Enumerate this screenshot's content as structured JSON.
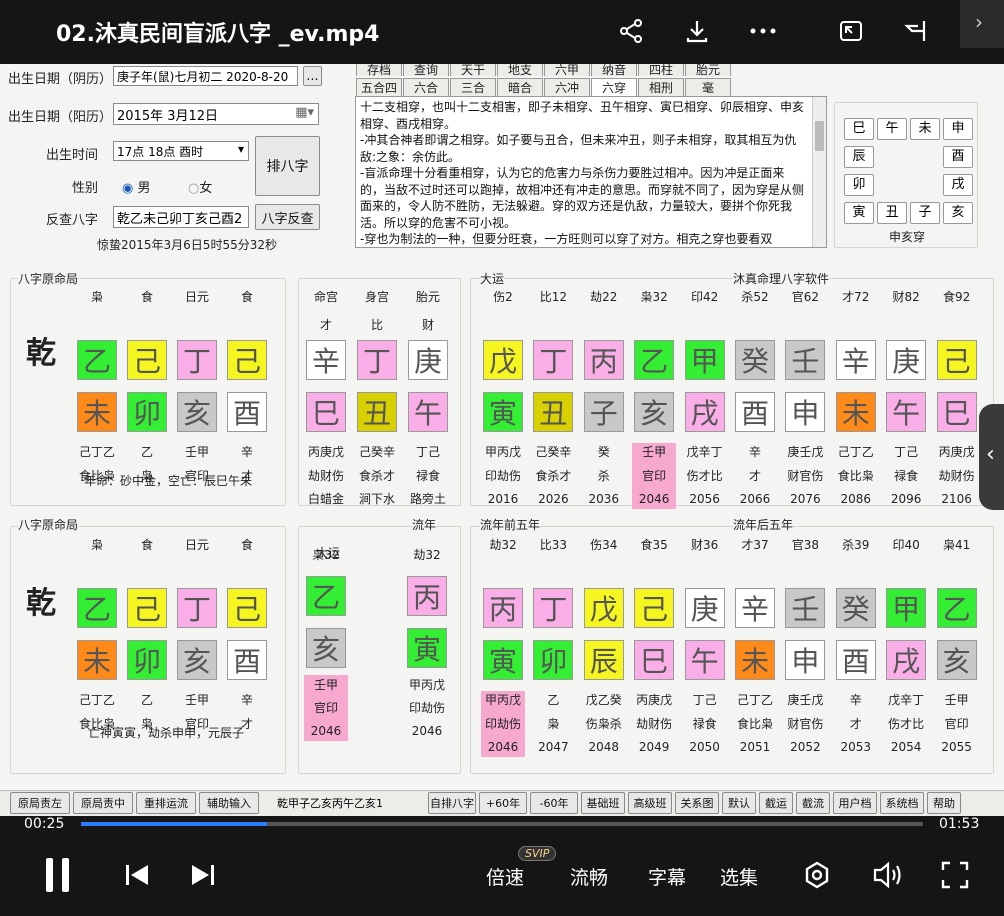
{
  "video": {
    "title": "02.沐真民间盲派八字 _ev.mp4",
    "current_time": "00:25",
    "duration": "01:53",
    "progress": 0.2212,
    "svip": "SVIP",
    "controls": [
      "倍速",
      "流畅",
      "字幕",
      "选集"
    ]
  },
  "form": {
    "lunar_label": "出生日期（阴历）",
    "lunar_value": "庚子年(鼠)七月初二 2020-8-20",
    "more": "...",
    "solar_label": "出生日期（阳历）",
    "solar_value": "2015年  3月12日",
    "time_label": "出生时间",
    "time_value": "17点 18点 酉时",
    "gender_label": "性别",
    "male": "男",
    "female": "女",
    "reverse_label": "反查八字",
    "reverse_value": "乾乙未己卯丁亥己酉2",
    "arrange_btn": "排八字",
    "reverse_btn": "八字反查",
    "jieqi": "惊蛰2015年3月6日5时55分32秒"
  },
  "tabs_row1": [
    "存档",
    "查询",
    "天干",
    "地支",
    "六甲",
    "纳音",
    "四柱",
    "胎元"
  ],
  "tabs_row2": [
    "五合四冲",
    "六合",
    "三合",
    "暗合",
    "六冲",
    "六穿",
    "相刑",
    "毫"
  ],
  "active_tab": "六穿",
  "text_panel": [
    "十二支相穿，也叫十二支相害，即子未相穿、丑午相穿、寅巳相穿、卯辰相穿、申亥相穿、酉戌相穿。",
    "  -冲其合神者即谓之相穿。如子要与丑合，但未来冲丑，则子未相穿，取其相互为仇敌:之象：余仿此。",
    "  -盲派命理十分看重相穿，认为它的危害力与杀伤力要胜过相冲。因为冲是正面来的，当敌不过时还可以跑掉，故相冲还有冲走的意思。而穿就不同了，因为穿是从侧面来的，令人防不胜防，无法躲避。穿的双方还是仇敌，力量较大，要拼个你死我活。所以穿的危害不可小视。",
    "  -穿也为制法的一种，但要分旺衰，一方旺则可以穿了对方。相克之穿也要看双"
  ],
  "zhi_grid": {
    "row1": [
      "巳",
      "午",
      "未",
      "申"
    ],
    "row2_left": "辰",
    "row2_right": "酉",
    "row3_left": "卯",
    "row3_right": "戌",
    "row4": [
      "寅",
      "丑",
      "子",
      "亥"
    ],
    "caption": "申亥穿"
  },
  "panel1": {
    "title": "八字原命局",
    "qian": "乾",
    "heads": [
      "枭",
      "食",
      "日元",
      "食"
    ],
    "stems": [
      "乙",
      "己",
      "丁",
      "己"
    ],
    "branches": [
      "未",
      "卯",
      "亥",
      "酉"
    ],
    "hidden": [
      "己丁乙",
      "乙",
      "壬甲",
      "辛"
    ],
    "gods": [
      "食比枭",
      "枭",
      "官印",
      "才"
    ],
    "note": "年命：砂中金，空亡：辰巳午未"
  },
  "panel2": {
    "heads": [
      "命宫",
      "身宫",
      "胎元"
    ],
    "sub": [
      "才",
      "比",
      "财"
    ],
    "stems": [
      "辛",
      "丁",
      "庚"
    ],
    "branches": [
      "巳",
      "丑",
      "午"
    ],
    "hidden": [
      "丙庚戊",
      "己癸辛",
      "丁己"
    ],
    "gods": [
      "劫财伤",
      "食杀才",
      "禄食"
    ],
    "nayin": [
      "白蜡金",
      "涧下水",
      "路旁土"
    ]
  },
  "panel3": {
    "title": "大运",
    "software": "沐真命理八字软件",
    "heads": [
      "伤2",
      "比12",
      "劫22",
      "枭32",
      "印42",
      "杀52",
      "官62",
      "才72",
      "财82",
      "食92"
    ],
    "stems": [
      "戊",
      "丁",
      "丙",
      "乙",
      "甲",
      "癸",
      "壬",
      "辛",
      "庚",
      "己"
    ],
    "branches": [
      "寅",
      "丑",
      "子",
      "亥",
      "戌",
      "酉",
      "申",
      "未",
      "午",
      "巳"
    ],
    "hidden": [
      "甲丙戊",
      "己癸辛",
      "癸",
      "壬甲",
      "戊辛丁",
      "辛",
      "庚壬戊",
      "己丁乙",
      "丁己",
      "丙庚戊"
    ],
    "gods": [
      "印劫伤",
      "食杀才",
      "杀",
      "官印",
      "伤才比",
      "才",
      "财官伤",
      "食比枭",
      "禄食",
      "劫财伤"
    ],
    "years": [
      "2016",
      "2026",
      "2036",
      "2046",
      "2056",
      "2066",
      "2076",
      "2086",
      "2096",
      "2106"
    ]
  },
  "panel4": {
    "title": "八字原命局",
    "qian": "乾",
    "heads": [
      "枭",
      "食",
      "日元",
      "食"
    ],
    "stems": [
      "乙",
      "己",
      "丁",
      "己"
    ],
    "branches": [
      "未",
      "卯",
      "亥",
      "酉"
    ],
    "hidden": [
      "己丁乙",
      "乙",
      "壬甲",
      "辛"
    ],
    "gods": [
      "食比枭",
      "枭",
      "官印",
      "才"
    ],
    "note": "亡神寅寅，劫杀申申，元辰子"
  },
  "panel5": {
    "t1": "大运",
    "t2": "流年",
    "h1": "枭32",
    "h2": "劫32",
    "s1": "乙",
    "s2": "丙",
    "b1": "亥",
    "b2": "寅",
    "hid1": "壬甲",
    "hid2": "甲丙戊",
    "god1": "官印",
    "god2": "印劫伤",
    "y1": "2046",
    "y2": "2046"
  },
  "panel6": {
    "title1": "流年前五年",
    "title2": "流年后五年",
    "heads": [
      "劫32",
      "比33",
      "伤34",
      "食35",
      "财36",
      "才37",
      "官38",
      "杀39",
      "印40",
      "枭41"
    ],
    "stems": [
      "丙",
      "丁",
      "戊",
      "己",
      "庚",
      "辛",
      "壬",
      "癸",
      "甲",
      "乙"
    ],
    "branches": [
      "寅",
      "卯",
      "辰",
      "巳",
      "午",
      "未",
      "申",
      "酉",
      "戌",
      "亥"
    ],
    "hidden": [
      "甲丙戊",
      "乙",
      "戊乙癸",
      "丙庚戊",
      "丁己",
      "己丁乙",
      "庚壬戊",
      "辛",
      "戊辛丁",
      "壬甲"
    ],
    "gods": [
      "印劫伤",
      "枭",
      "伤枭杀",
      "劫财伤",
      "禄食",
      "食比枭",
      "财官伤",
      "才",
      "伤才比",
      "官印"
    ],
    "years": [
      "2046",
      "2047",
      "2048",
      "2049",
      "2050",
      "2051",
      "2052",
      "2053",
      "2054",
      "2055"
    ]
  },
  "bottom_bar": {
    "buttons": [
      "原局责左",
      "原局责中",
      "重排运流",
      "辅助输入"
    ],
    "input": "乾甲子乙亥丙午乙亥1",
    "buttons2": [
      "自排八字",
      "+60年",
      "-60年",
      "基础班",
      "高级班",
      "关系图",
      "默认",
      "截运",
      "截流",
      "用户档",
      "系统档",
      "帮助"
    ]
  },
  "colors": {
    "木": "#33ee33",
    "火": "#f9aee8",
    "土": "#f5f520",
    "金": "#ffffff",
    "水": "#c8c8c8",
    "土2": "#d8d000",
    "未": "#ff8a1a"
  }
}
